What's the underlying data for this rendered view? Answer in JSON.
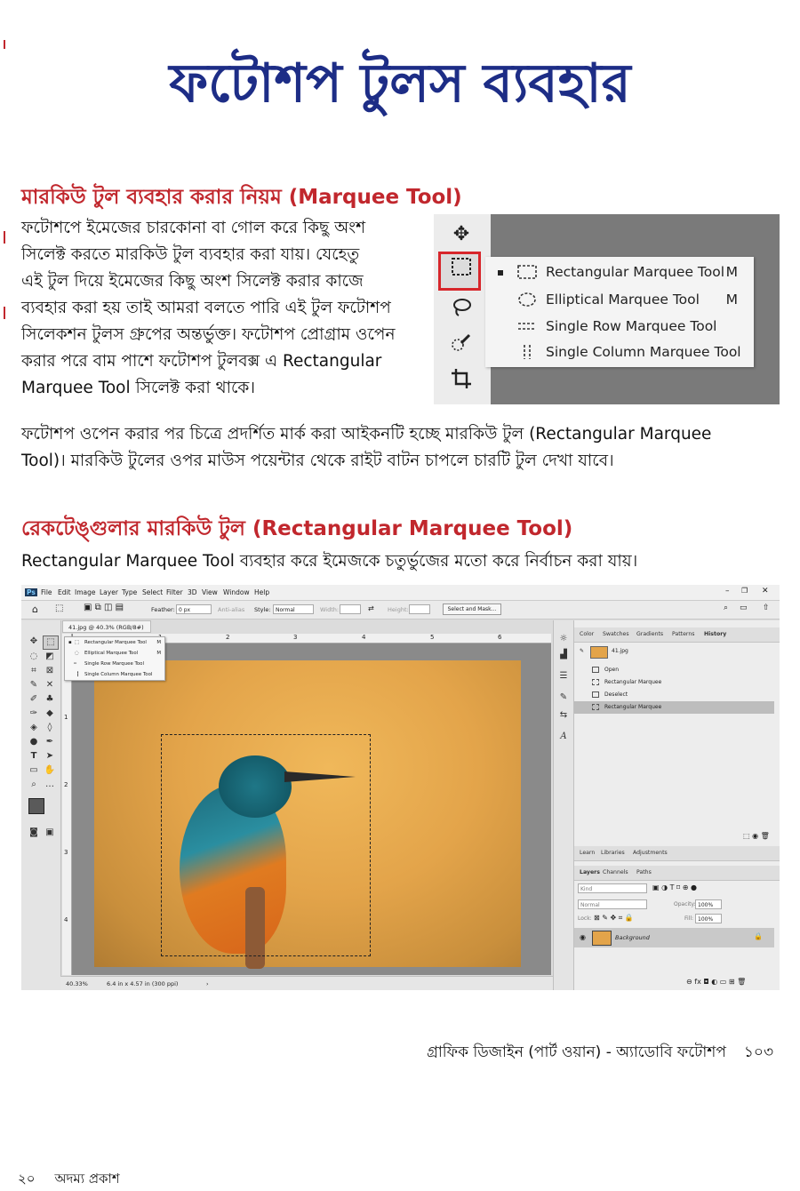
{
  "page": {
    "title": "ফটোশপ টুলস ব্যবহার"
  },
  "section1": {
    "heading": "মারকিউ টুল ব্যবহার করার নিয়ম (Marquee Tool)",
    "lines": [
      "ফটোশপে ইমেজের চারকোনা বা গোল করে কিছু অংশ",
      "সিলেক্ট করতে মারকিউ টুল ব্যবহার করা যায়। যেহেতু",
      "এই টুল দিয়ে ইমেজের কিছু অংশ সিলেক্ট করার কাজে",
      "ব্যবহার করা হয় তাই আমরা বলতে পারি এই টুল ফটোশপ",
      "সিলেকশন টুলস গ্রুপের অন্তর্ভুক্ত। ফটোশপ প্রোগ্রাম ওপেন",
      "করার পরে বাম পাশে ফটোশপ টুলবক্স এ Rectangular",
      "Marquee Tool সিলেক্ট করা থাকে।"
    ],
    "para2": [
      "ফটোশপ ওপেন করার পর চিত্রে প্রদর্শিত মার্ক করা আইকনটি হচ্ছে মারকিউ টুল (Rectangular Marquee",
      "Tool)। মারকিউ টুলের ওপর মাউস পয়েন্টার থেকে রাইট বাটন চাপলে চারটি টুল দেখা যাবে।"
    ]
  },
  "toolmenu": {
    "items": [
      {
        "label": "Rectangular Marquee Tool",
        "key": "M"
      },
      {
        "label": "Elliptical Marquee Tool",
        "key": "M"
      },
      {
        "label": "Single Row Marquee Tool",
        "key": ""
      },
      {
        "label": "Single Column Marquee Tool",
        "key": ""
      }
    ]
  },
  "section2": {
    "heading": "রেকটেঙ্গুলার মারকিউ টুল (Rectangular Marquee Tool)",
    "text": "Rectangular Marquee Tool ব্যবহার করে ইমেজকে চতুর্ভুজের মতো করে নির্বাচন করা যায়।"
  },
  "ps": {
    "menu": [
      "File",
      "Edit",
      "Image",
      "Layer",
      "Type",
      "Select",
      "Filter",
      "3D",
      "View",
      "Window",
      "Help"
    ],
    "feather_label": "Feather:",
    "feather_value": "0 px",
    "antialias": "Anti-alias",
    "style_label": "Style:",
    "style_value": "Normal",
    "width_label": "Width:",
    "height_label": "Height:",
    "select_mask": "Select and Mask...",
    "doc_tab": "41.jpg @ 40.3% (RGB/8#)",
    "ruler_h": [
      "1",
      "2",
      "3",
      "4",
      "5",
      "6"
    ],
    "ruler_v": [
      "1",
      "2",
      "3",
      "4"
    ],
    "zoom": "40.33%",
    "docsize": "6.4 in x 4.57 in (300 ppi)",
    "flyout": [
      {
        "label": "Rectangular Marquee Tool",
        "key": "M"
      },
      {
        "label": "Elliptical Marquee Tool",
        "key": "M"
      },
      {
        "label": "Single Row Marquee Tool",
        "key": ""
      },
      {
        "label": "Single Column Marquee Tool",
        "key": ""
      }
    ],
    "panel_tabs": [
      "Color",
      "Swatches",
      "Gradients",
      "Patterns",
      "History"
    ],
    "history_file": "41.jpg",
    "history": [
      "Open",
      "Rectangular Marquee",
      "Deselect",
      "Rectangular Marquee"
    ],
    "learn_tabs": [
      "Learn",
      "Libraries",
      "Adjustments"
    ],
    "layer_tabs": [
      "Layers",
      "Channels",
      "Paths"
    ],
    "kind": "Kind",
    "blend": "Normal",
    "opacity_label": "Opacity:",
    "opacity_value": "100%",
    "lock_label": "Lock:",
    "fill_label": "Fill:",
    "fill_value": "100%",
    "layer_name": "Background"
  },
  "footer": {
    "book": "গ্রাফিক ডিজাইন (পার্ট ওয়ান) - অ্যাডোবি ফটোশপ",
    "page_no": "১০৩"
  },
  "bottom": {
    "page_no": "২০",
    "publisher": "অদম্য প্রকাশ"
  }
}
